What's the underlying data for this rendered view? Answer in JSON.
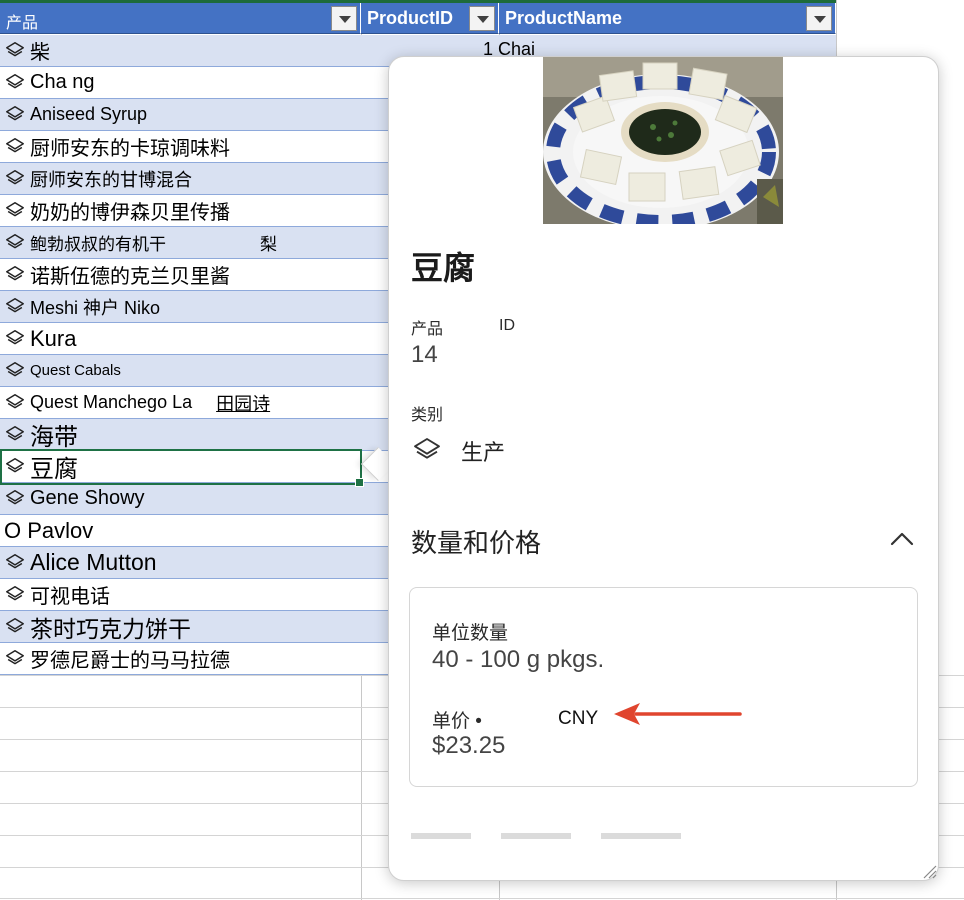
{
  "grid": {
    "headers": [
      {
        "label": "产品"
      },
      {
        "label": "ProductID"
      },
      {
        "label": "ProductName"
      }
    ],
    "rows": [
      {
        "name": "柴",
        "id": "1",
        "product": "Chai"
      },
      {
        "name": "Cha ng"
      },
      {
        "name": "Aniseed Syrup"
      },
      {
        "name": "厨师安东的卡琼调味料"
      },
      {
        "name": "厨师安东的甘博混合"
      },
      {
        "name": "奶奶的博伊森贝里传播"
      },
      {
        "name": "鲍勃叔叔的有机干",
        "extra": "梨"
      },
      {
        "name": "诺斯伍德的克兰贝里酱"
      },
      {
        "name": "Meshi 神户 Niko"
      },
      {
        "name": "Kura"
      },
      {
        "name": "Quest Cabals"
      },
      {
        "name": "Quest Manchego La",
        "extra": "田园诗"
      },
      {
        "name": "海带"
      },
      {
        "name": "豆腐"
      },
      {
        "name": "Gene Showy"
      },
      {
        "name": "O Pavlov"
      },
      {
        "name": "Alice Mutton"
      },
      {
        "name": "可视电话"
      },
      {
        "name": "茶时巧克力饼干"
      },
      {
        "name": "罗德尼爵士的马马拉德"
      }
    ]
  },
  "card": {
    "title": "豆腐",
    "product_id_label_a": "产品",
    "product_id_label_b": "ID",
    "product_id_value": "14",
    "category_label": "类别",
    "category_value": "生产",
    "section_title": "数量和价格",
    "unit_qty_label": "单位数量",
    "unit_qty_value": "40 - 100 g pkgs.",
    "unit_price_label": "单价 •",
    "currency": "CNY",
    "unit_price_value": "$23.25"
  },
  "icons": {
    "row_icon": "layers-icon",
    "category_icon": "layers-icon",
    "section_toggle": "chevron-up-icon",
    "dropdown": "filter-dropdown-icon",
    "annotation": "red-arrow-icon"
  },
  "colors": {
    "header_bg": "#4472c4",
    "band_row": "#d9e1f2",
    "selection": "#1e7145",
    "arrow": "#e0452e"
  }
}
